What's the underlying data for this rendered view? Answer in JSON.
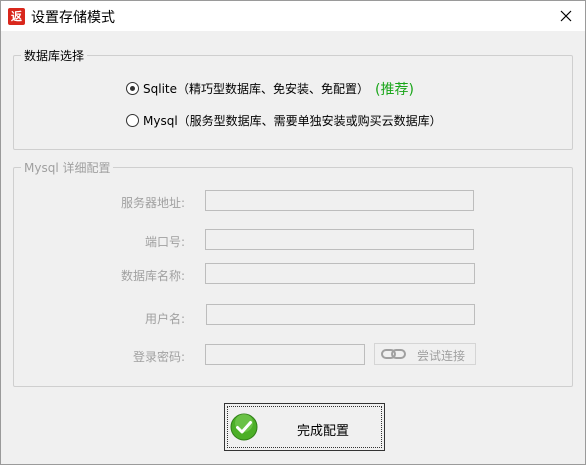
{
  "window": {
    "title": "设置存储模式",
    "icon_char": "返",
    "icon_color": "#d9271c"
  },
  "db_group": {
    "legend": "数据库选择",
    "options": [
      {
        "label": "Sqlite（精巧型数据库、免安装、免配置）",
        "checked": true
      },
      {
        "label": "Mysql（服务型数据库、需要单独安装或购买云数据库）",
        "checked": false
      }
    ],
    "recommend_label": "(推荐)",
    "recommend_color": "#19a519"
  },
  "mysql_group": {
    "legend": "Mysql 详细配置",
    "fields": [
      {
        "label": "服务器地址:",
        "value": ""
      },
      {
        "label": "端口号:",
        "value": ""
      },
      {
        "label": "数据库名称:",
        "value": ""
      },
      {
        "label": "用户名:",
        "value": ""
      },
      {
        "label": "登录密码:",
        "value": ""
      }
    ],
    "test_button_label": "尝试连接"
  },
  "finish_button_label": "完成配置"
}
